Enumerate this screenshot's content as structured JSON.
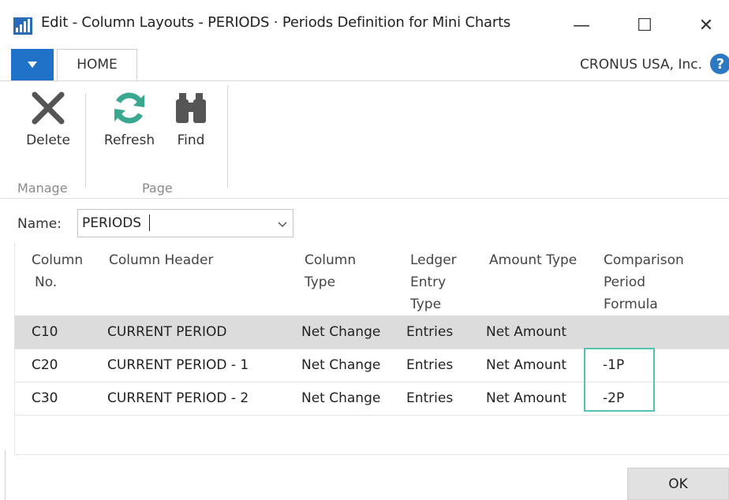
{
  "window": {
    "title": "Edit - Column Layouts - PERIODS · Periods Definition for Mini Charts",
    "minimize_glyph": "—",
    "maximize_glyph": "☐",
    "close_glyph": "✕"
  },
  "ribbon": {
    "tab_home": "HOME",
    "company": "CRONUS USA, Inc.",
    "help_glyph": "?",
    "actions": {
      "delete": "Delete",
      "refresh": "Refresh",
      "find": "Find"
    },
    "groups": {
      "manage": "Manage",
      "page": "Page"
    }
  },
  "form": {
    "name_label": "Name:",
    "name_value": "PERIODS"
  },
  "grid": {
    "headers": {
      "column_no": [
        "Column",
        "No."
      ],
      "column_header": [
        "Column Header"
      ],
      "column_type": [
        "Column",
        "Type"
      ],
      "ledger_entry_type": [
        "Ledger",
        "Entry",
        "Type"
      ],
      "amount_type": [
        "Amount Type"
      ],
      "comparison_period_formula": [
        "Comparison",
        "Period",
        "Formula"
      ]
    },
    "rows": [
      {
        "column_no": "C10",
        "column_header": "CURRENT PERIOD",
        "column_type": "Net Change",
        "ledger_entry_type": "Entries",
        "amount_type": "Net Amount",
        "formula": ""
      },
      {
        "column_no": "C20",
        "column_header": "CURRENT PERIOD - 1",
        "column_type": "Net Change",
        "ledger_entry_type": "Entries",
        "amount_type": "Net Amount",
        "formula": "-1P"
      },
      {
        "column_no": "C30",
        "column_header": "CURRENT PERIOD - 2",
        "column_type": "Net Change",
        "ledger_entry_type": "Entries",
        "amount_type": "Net Amount",
        "formula": "-2P"
      }
    ]
  },
  "footer": {
    "ok_label": "OK"
  },
  "colors": {
    "accent": "#2072c8",
    "refresh_green": "#3aa88f",
    "selected_row": "#dcdcdc",
    "highlight_border": "#55c2b2"
  }
}
